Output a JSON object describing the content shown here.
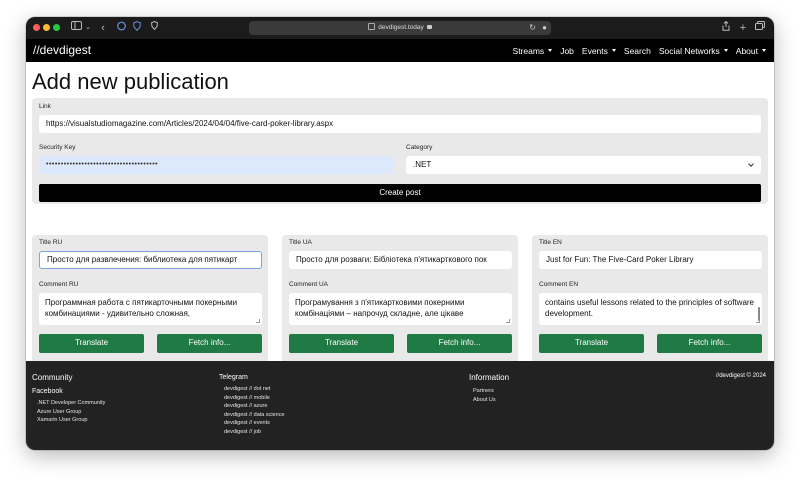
{
  "browser": {
    "url": "devdigest.today"
  },
  "site": {
    "logo": "//devdigest",
    "nav": [
      {
        "label": "Streams",
        "dropdown": true
      },
      {
        "label": "Job",
        "dropdown": false
      },
      {
        "label": "Events",
        "dropdown": true
      },
      {
        "label": "Search",
        "dropdown": false
      },
      {
        "label": "Social Networks",
        "dropdown": true
      },
      {
        "label": "About",
        "dropdown": true
      }
    ]
  },
  "page": {
    "title": "Add new publication"
  },
  "form": {
    "link_label": "Link",
    "link_value": "https://visualstudiomagazine.com/Articles/2024/04/04/five-card-poker-library.aspx",
    "security_key_label": "Security Key",
    "security_key_value": "••••••••••••••••••••••••••••••••••••••",
    "category_label": "Category",
    "category_value": ".NET",
    "create_button": "Create post"
  },
  "columns": [
    {
      "title_label": "Title RU",
      "title_value": "Просто для развлечения: библиотека для пятикарт",
      "comment_label": "Comment RU",
      "comment_value": "Программная работа с пятикарточными покерными комбинациями - удивительно сложная,",
      "translate_button": "Translate",
      "fetch_button": "Fetch info..."
    },
    {
      "title_label": "Title UA",
      "title_value": "Просто для розваги: Бібліотека п'ятикарткового пок",
      "comment_label": "Comment UA",
      "comment_value": "Програмування з п'ятикартковими покерними комбінаціями – напрочуд складне, але цікаве",
      "translate_button": "Translate",
      "fetch_button": "Fetch info..."
    },
    {
      "title_label": "Title EN",
      "title_value": "Just for Fun: The Five-Card Poker Library",
      "comment_label": "Comment EN",
      "comment_value": "contains useful lessons related to the principles of software development.",
      "translate_button": "Translate",
      "fetch_button": "Fetch info..."
    }
  ],
  "footer": {
    "community": {
      "heading": "Community",
      "subheading": "Facebook",
      "items": [
        ".NET Developer Community",
        "Azure User Group",
        "Xamarin User Group"
      ]
    },
    "telegram": {
      "heading": "Telegram",
      "items": [
        "devdigest // dot net",
        "devdigest // mobile",
        "devdigest // azure",
        "devdigest // data science",
        "devdigest // events",
        "devdigest // job"
      ]
    },
    "information": {
      "heading": "Information",
      "items": [
        "Partners",
        "About Us"
      ]
    },
    "copyright": "//devdigest © 2024"
  }
}
